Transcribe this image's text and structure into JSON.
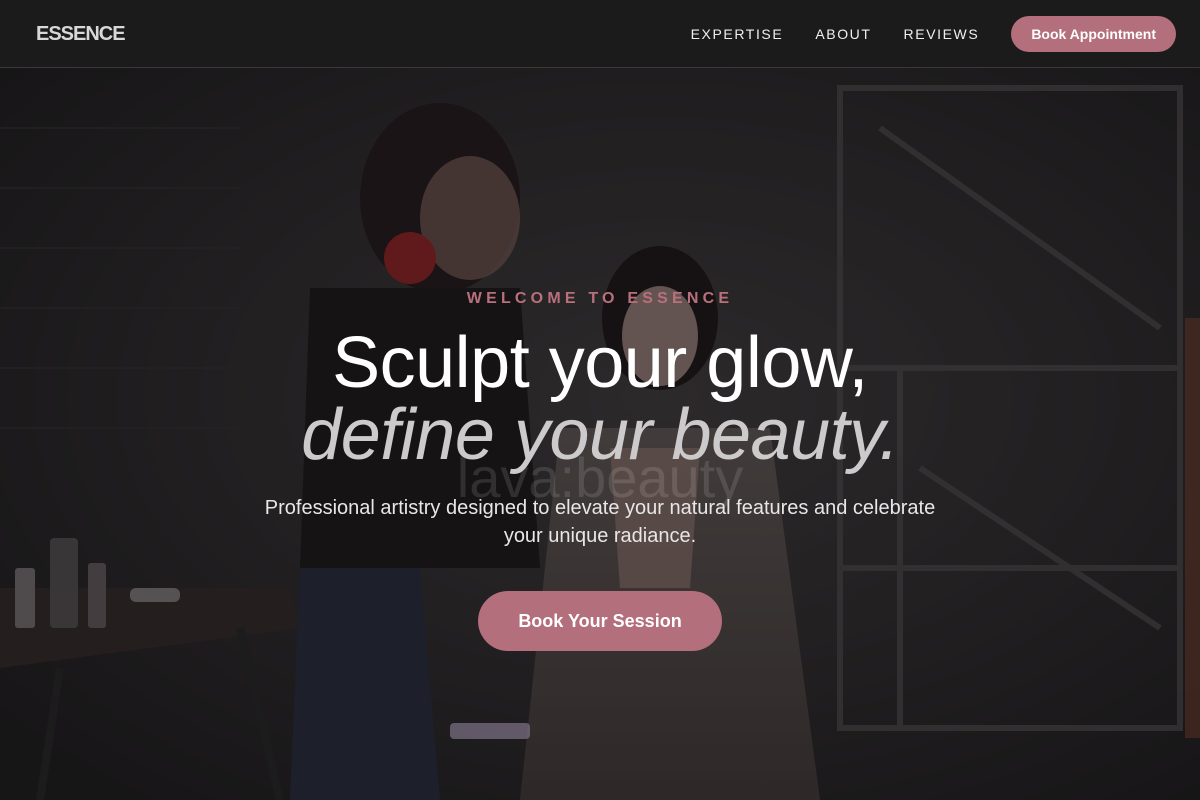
{
  "brand": {
    "logo_text": "ESSENCE"
  },
  "nav": {
    "items": [
      {
        "label": "EXPERTISE"
      },
      {
        "label": "ABOUT"
      },
      {
        "label": "REVIEWS"
      }
    ],
    "book_button": "Book Appointment"
  },
  "hero": {
    "eyebrow": "WELCOME TO ESSENCE",
    "headline_line1": "Sculpt your glow,",
    "headline_line2": "define your beauty.",
    "photo_watermark": "lava:beauty",
    "subtext": "Professional artistry designed to elevate your natural features and celebrate your unique radiance.",
    "cta_label": "Book Your Session",
    "background_image": "makeup-artist-applying-makeup-photo"
  },
  "colors": {
    "accent": "#b36f7b",
    "eyebrow": "#b9707d",
    "header_bg": "#1c1b1c",
    "text_primary": "#ffffff",
    "text_muted": "#cdcacb"
  }
}
